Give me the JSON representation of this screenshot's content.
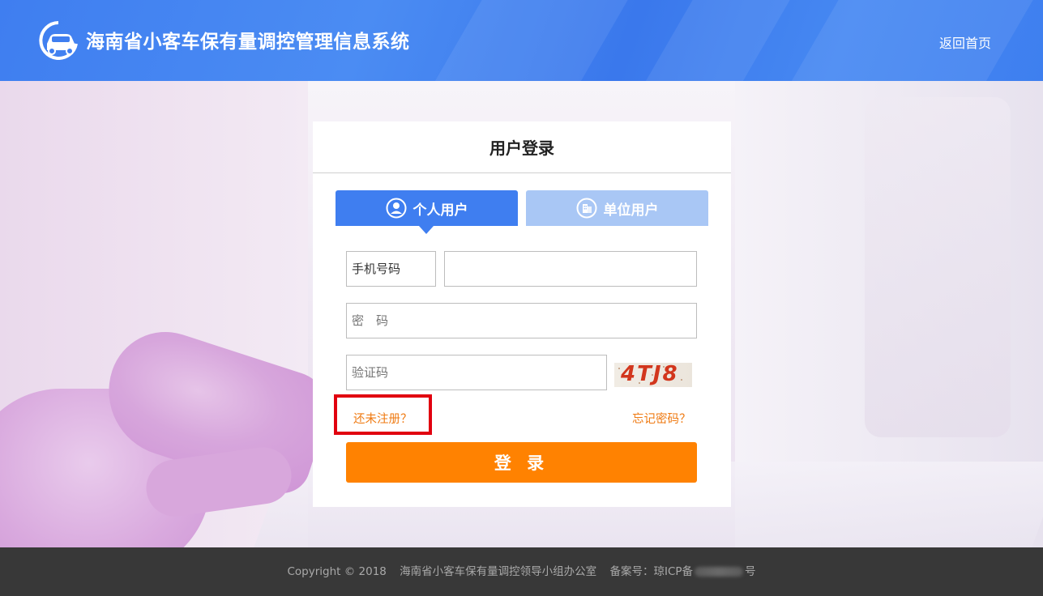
{
  "header": {
    "site_title": "海南省小客车保有量调控管理信息系统",
    "home_link": "返回首页",
    "logo_icon": "car-logo-icon"
  },
  "login_card": {
    "title": "用户登录",
    "tabs": [
      {
        "label": "个人用户",
        "icon": "user-circle-icon",
        "active": true
      },
      {
        "label": "单位用户",
        "icon": "building-icon",
        "active": false
      }
    ],
    "phone_label": "手机号码",
    "phone_value": "",
    "password_placeholder": "密　码",
    "captcha_placeholder": "验证码",
    "captcha_text": "4TJ8",
    "register_link": "还未注册？",
    "forgot_link": "忘记密码？",
    "login_button": "登 录"
  },
  "footer": {
    "copyright": "Copyright  © 2018",
    "organization": "海南省小客车保有量调控领导小组办公室",
    "icp_prefix": "备案号：琼ICP备",
    "icp_suffix": "号"
  },
  "colors": {
    "header_blue": "#3f7ef0",
    "tab_inactive": "#a9c7f5",
    "accent_orange": "#ff8201",
    "link_orange": "#ef7a12",
    "highlight_red": "#e1000f",
    "footer_bg": "#383838"
  }
}
